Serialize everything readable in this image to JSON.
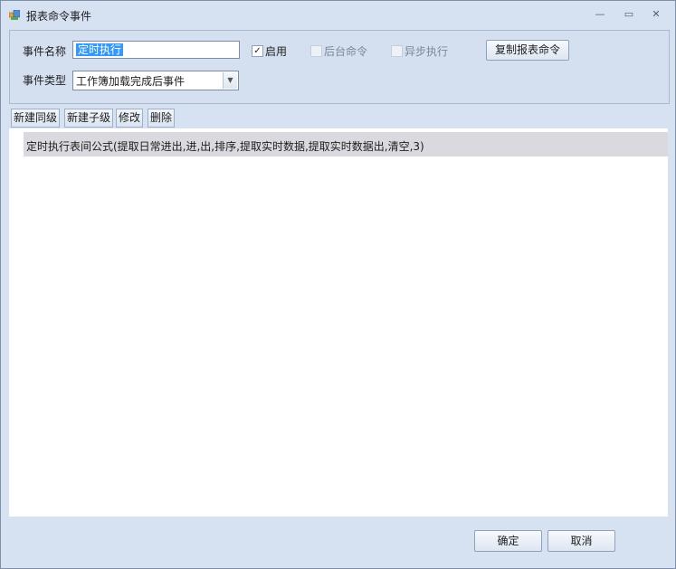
{
  "window": {
    "title": "报表命令事件",
    "controls": {
      "minimize": "—",
      "maximize": "▭",
      "close": "✕"
    }
  },
  "form": {
    "event_name_label": "事件名称",
    "event_name_value": "定时执行",
    "enable": {
      "label": "启用",
      "checked": true
    },
    "background_cmd": {
      "label": "后台命令",
      "checked": false,
      "enabled": false
    },
    "async_exec": {
      "label": "异步执行",
      "checked": false,
      "enabled": false
    },
    "copy_button": "复制报表命令",
    "event_type_label": "事件类型",
    "event_type_value": "工作簿加载完成后事件"
  },
  "toolbar": {
    "new_sibling": "新建同级",
    "new_child": "新建子级",
    "edit": "修改",
    "delete": "删除"
  },
  "commands": [
    {
      "text": "定时执行表间公式(提取日常进出,进,出,排序,提取实时数据,提取实时数据出,清空,3)"
    }
  ],
  "footer": {
    "ok": "确定",
    "cancel": "取消"
  },
  "colors": {
    "window_bg": "#d6e2f1",
    "selection": "#3399ff",
    "row_highlight": "#d9d9df"
  }
}
